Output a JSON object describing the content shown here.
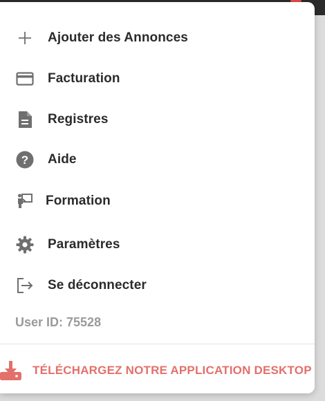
{
  "menu": {
    "items": [
      {
        "id": "add",
        "label": "Ajouter des Annonces",
        "icon": "plus-icon"
      },
      {
        "id": "billing",
        "label": "Facturation",
        "icon": "credit-card-icon"
      },
      {
        "id": "registers",
        "label": "Registres",
        "icon": "document-icon"
      },
      {
        "id": "help",
        "label": "Aide",
        "icon": "help-circle-icon"
      },
      {
        "id": "training",
        "label": "Formation",
        "icon": "presentation-icon"
      },
      {
        "id": "settings",
        "label": "Paramètres",
        "icon": "gear-icon"
      },
      {
        "id": "logout",
        "label": "Se déconnecter",
        "icon": "logout-icon"
      }
    ],
    "user_id": "User ID: 75528",
    "download_label": "TÉLÉCHARGEZ NOTRE APPLICATION DESKTOP"
  },
  "colors": {
    "text": "#2b2b2b",
    "icon": "#6f6f6f",
    "muted": "#9a9a9a",
    "accent": "#e2706b"
  }
}
